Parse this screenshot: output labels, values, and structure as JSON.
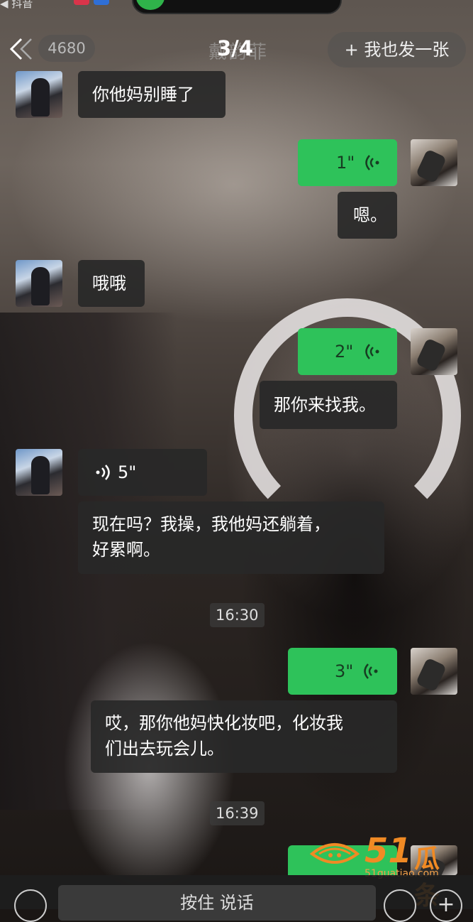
{
  "status": {
    "back_label": "◀ 抖音"
  },
  "header": {
    "badge_count": "4680",
    "chat_name": "戴韵菲",
    "page_indicator": "3/4",
    "post_button": "+ 我也发一张"
  },
  "messages": [
    {
      "side": "left",
      "type": "text",
      "text": "你他妈别睡了"
    },
    {
      "side": "right",
      "type": "voice",
      "duration": "1\""
    },
    {
      "side": "right",
      "type": "text",
      "text": "嗯。"
    },
    {
      "side": "left",
      "type": "text",
      "text": "哦哦"
    },
    {
      "side": "right",
      "type": "voice",
      "duration": "2\""
    },
    {
      "side": "right",
      "type": "text",
      "text": "那你来找我。"
    },
    {
      "side": "left",
      "type": "voice",
      "duration": "5\""
    },
    {
      "side": "left",
      "type": "text",
      "text_line1": "现在吗？我操，我他妈还躺着，",
      "text_line2": "好累啊。"
    },
    {
      "type": "time",
      "text": "16:30"
    },
    {
      "side": "right",
      "type": "voice",
      "duration": "3\""
    },
    {
      "side": "right",
      "type": "text",
      "text_line1": "哎，那你他妈快化妆吧，化妆我",
      "text_line2": "们出去玩会儿。"
    },
    {
      "type": "time",
      "text": "16:39"
    }
  ],
  "bottom": {
    "hold_to_talk": "按住 说话",
    "plus": "+"
  },
  "watermark": {
    "brand_num": "51",
    "brand_cn": "瓜条",
    "url": "51guatiao.com"
  },
  "colors": {
    "voice_bubble": "#2ec25a",
    "watermark": "#f08a24"
  }
}
